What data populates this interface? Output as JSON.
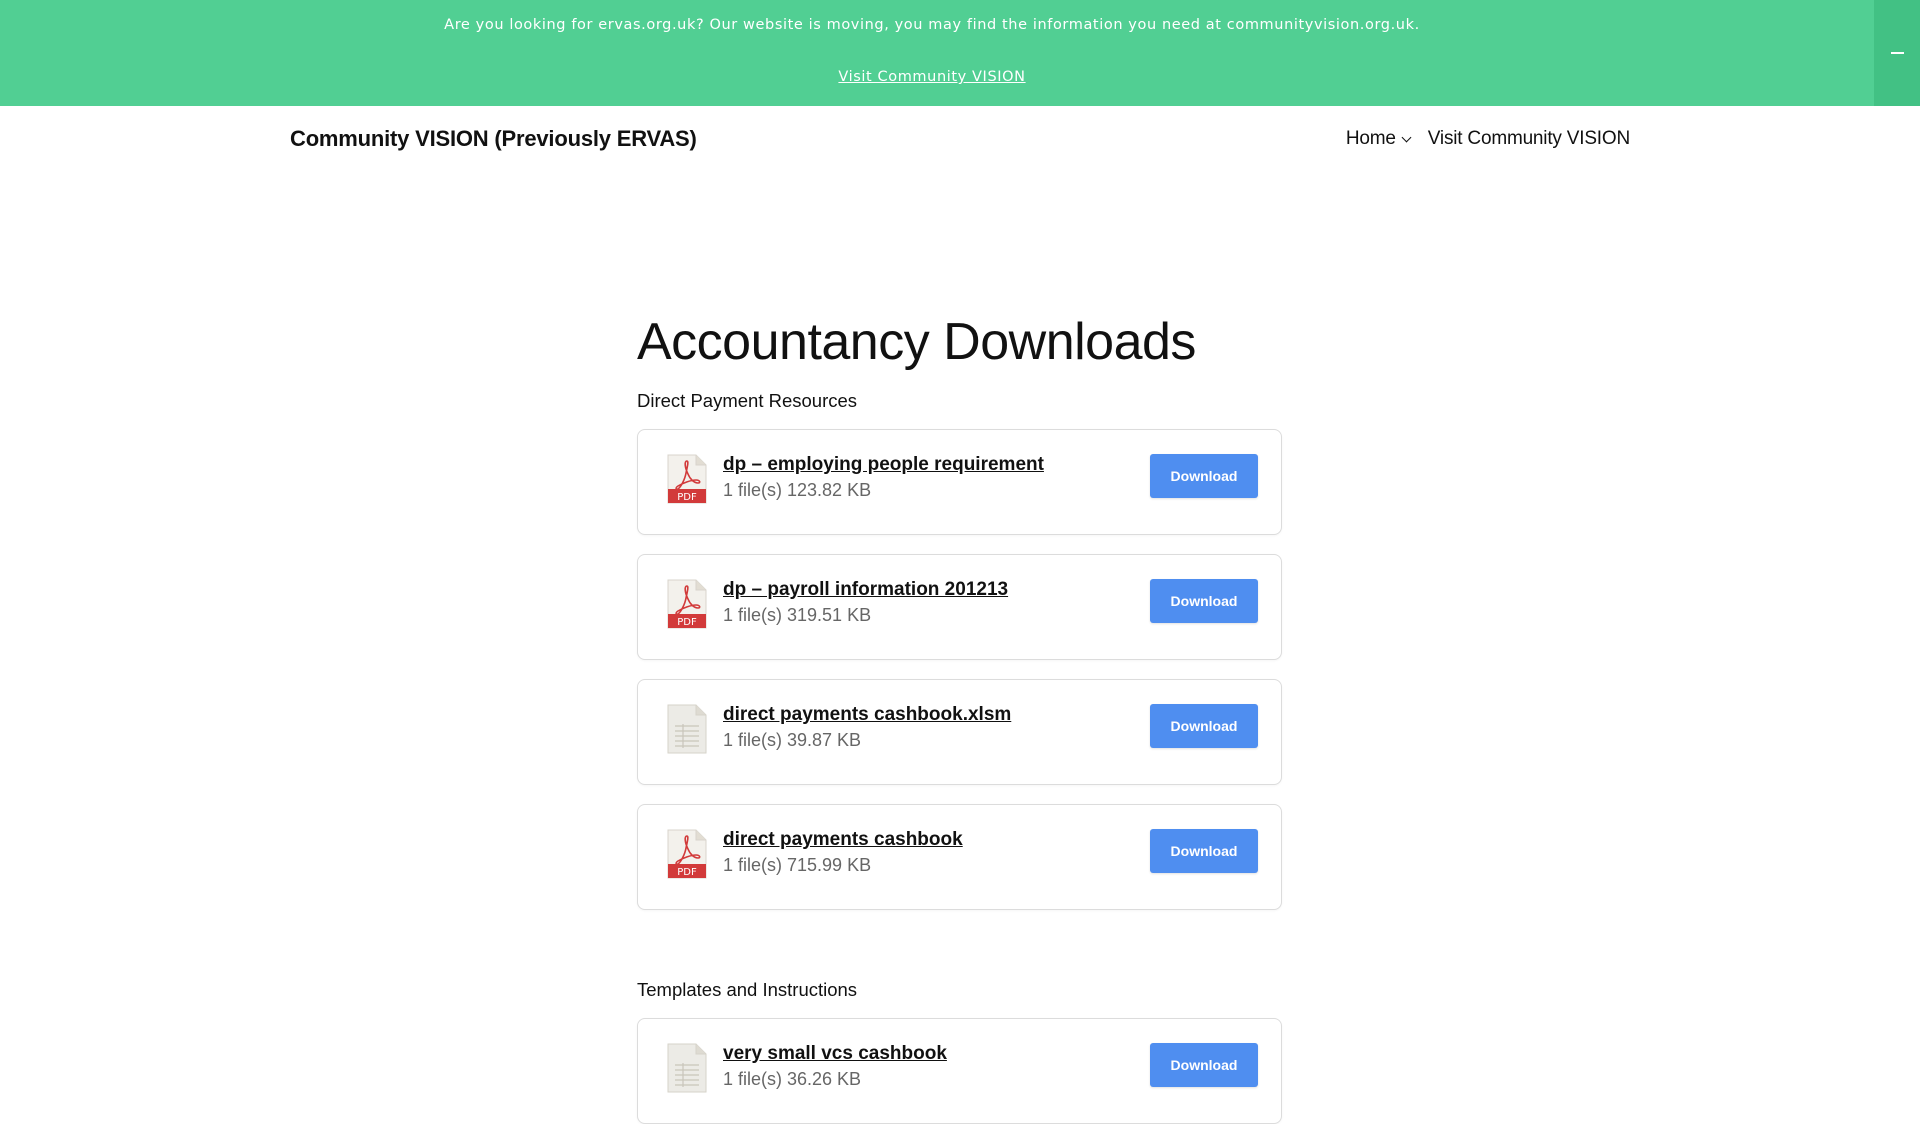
{
  "notice": {
    "text": "Are you looking for ervas.org.uk? Our website is moving, you may find the information you need at communityvision.org.uk.",
    "link_label": "Visit Community VISION"
  },
  "header": {
    "site_title": "Community VISION (Previously ERVAS)",
    "nav": [
      {
        "label": "Home",
        "has_submenu": true
      },
      {
        "label": "Visit Community VISION",
        "has_submenu": false
      }
    ]
  },
  "main": {
    "title": "Accountancy Downloads",
    "sections": [
      {
        "heading": "Direct Payment Resources",
        "items": [
          {
            "name": "dp – employing people requirement",
            "meta": "1 file(s) 123.82 KB",
            "icon": "pdf-icon",
            "button": "Download"
          },
          {
            "name": "dp – payroll information 201213",
            "meta": "1 file(s) 319.51 KB",
            "icon": "pdf-icon",
            "button": "Download"
          },
          {
            "name": "direct payments cashbook.xlsm",
            "meta": "1 file(s) 39.87 KB",
            "icon": "spreadsheet-icon",
            "button": "Download"
          },
          {
            "name": "direct payments cashbook",
            "meta": "1 file(s) 715.99 KB",
            "icon": "pdf-icon",
            "button": "Download"
          }
        ]
      },
      {
        "heading": "Templates and Instructions",
        "items": [
          {
            "name": "very small vcs cashbook",
            "meta": "1 file(s) 36.26 KB",
            "icon": "spreadsheet-icon",
            "button": "Download"
          }
        ]
      }
    ]
  },
  "colors": {
    "banner": "#51cf93",
    "banner_toggle": "#42c184",
    "button": "#4f8ef0",
    "pdf_red": "#d23a3a"
  }
}
